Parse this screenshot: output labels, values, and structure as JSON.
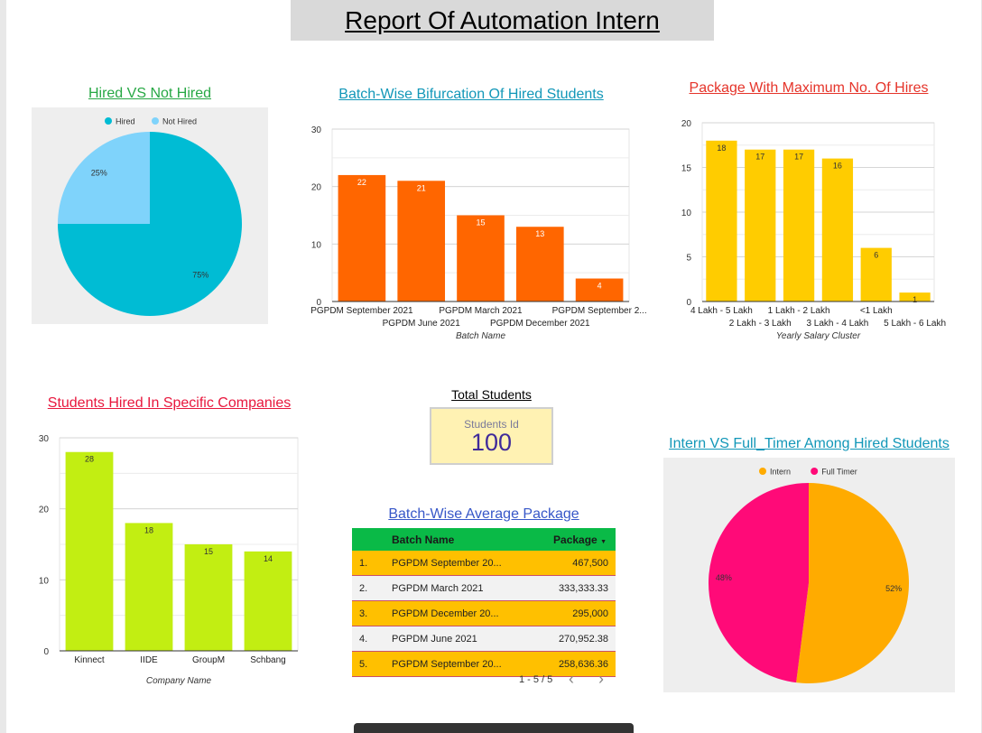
{
  "report_title": "Report Of Automation Intern",
  "scorecard": {
    "title": "Total Students",
    "label": "Students Id",
    "value": "100"
  },
  "table": {
    "title": "Batch-Wise Average Package",
    "headers": [
      "Batch Name",
      "Package"
    ],
    "sort_icon": "sort-down-icon",
    "rows": [
      {
        "index": "1.",
        "name": "PGPDM September 20...",
        "value": "467,500"
      },
      {
        "index": "2.",
        "name": "PGPDM March 2021",
        "value": "333,333.33"
      },
      {
        "index": "3.",
        "name": "PGPDM December 20...",
        "value": "295,000"
      },
      {
        "index": "4.",
        "name": "PGPDM June 2021",
        "value": "270,952.38"
      },
      {
        "index": "5.",
        "name": "PGPDM September 20...",
        "value": "258,636.36"
      }
    ],
    "pagination": "1 - 5 / 5"
  },
  "colors": {
    "pie1_hired": "#00bcd4",
    "pie1_not_hired": "#7fd3fb",
    "batch_bar": "#ff6600",
    "package_bar": "#ffcc00",
    "company_bar": "#c2ee12",
    "pie2_intern": "#ffab00",
    "pie2_full": "#ff0a78",
    "title_green": "#27a844",
    "title_teal": "#1297b8",
    "title_red": "#e5342a",
    "title_crimson": "#e8173d",
    "title_blue": "#3757c8"
  },
  "chart_data": [
    {
      "type": "pie",
      "title": "Hired VS Not Hired",
      "labels": [
        "Hired",
        "Not Hired"
      ],
      "values": [
        75,
        25
      ],
      "slice_labels": [
        "75%",
        "25%"
      ],
      "legend": "top"
    },
    {
      "type": "bar",
      "title": "Batch-Wise Bifurcation Of Hired Students",
      "categories": [
        "PGPDM September 2021",
        "PGPDM June 2021",
        "PGPDM March 2021",
        "PGPDM December 2021",
        "PGPDM September 2..."
      ],
      "values": [
        22,
        21,
        15,
        13,
        4
      ],
      "xlabel": "Batch Name",
      "ylabel": "",
      "ylim": [
        0,
        30
      ],
      "yticks": [
        0,
        10,
        20,
        30
      ],
      "grid": true
    },
    {
      "type": "bar",
      "title": "Package With Maximum No. Of Hires",
      "categories": [
        "4 Lakh - 5 Lakh",
        "2 Lakh - 3 Lakh",
        "1 Lakh - 2 Lakh",
        "3 Lakh - 4 Lakh",
        "<1 Lakh",
        "5 Lakh - 6 Lakh"
      ],
      "values": [
        18,
        17,
        17,
        16,
        6,
        1
      ],
      "xlabel": "Yearly Salary Cluster",
      "ylabel": "",
      "ylim": [
        0,
        20
      ],
      "yticks": [
        0,
        5,
        10,
        15,
        20
      ],
      "grid": true
    },
    {
      "type": "bar",
      "title": "Students Hired In Specific Companies",
      "categories": [
        "Kinnect",
        "IIDE",
        "GroupM",
        "Schbang"
      ],
      "values": [
        28,
        18,
        15,
        14
      ],
      "xlabel": "Company Name",
      "ylabel": "",
      "ylim": [
        0,
        30
      ],
      "yticks": [
        0,
        10,
        20,
        30
      ],
      "grid": true
    },
    {
      "type": "pie",
      "title": "Intern VS Full_Timer Among Hired Students",
      "labels": [
        "Intern",
        "Full Timer"
      ],
      "values": [
        52,
        48
      ],
      "slice_labels": [
        "52%",
        "48%"
      ],
      "legend": "top"
    }
  ]
}
